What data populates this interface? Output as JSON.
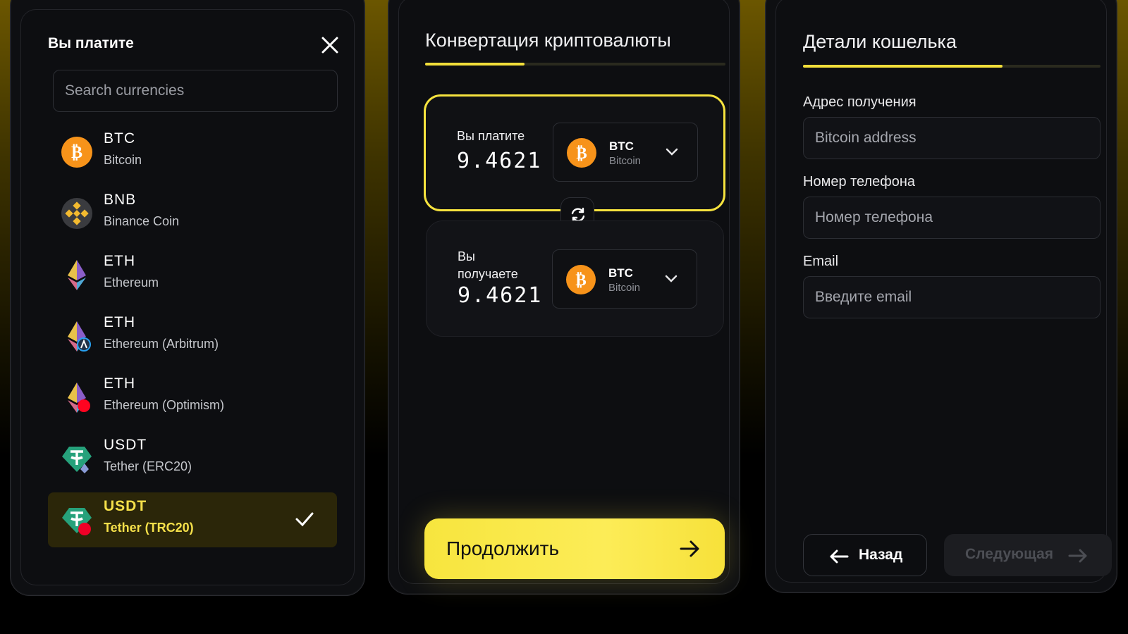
{
  "picker": {
    "title": "Вы платите",
    "search_placeholder": "Search currencies",
    "items": [
      {
        "symbol": "BTC",
        "name": "Bitcoin",
        "icon": "bitcoin-icon"
      },
      {
        "symbol": "BNB",
        "name": "Binance Coin",
        "icon": "binance-icon"
      },
      {
        "symbol": "ETH",
        "name": "Ethereum",
        "icon": "ethereum-icon"
      },
      {
        "symbol": "ETH",
        "name": "Ethereum (Arbitrum)",
        "icon": "ethereum-arbitrum-icon"
      },
      {
        "symbol": "ETH",
        "name": "Ethereum (Optimism)",
        "icon": "ethereum-optimism-icon"
      },
      {
        "symbol": "USDT",
        "name": "Tether (ERC20)",
        "icon": "tether-erc20-icon"
      },
      {
        "symbol": "USDT",
        "name": "Tether (TRC20)",
        "icon": "tether-trc20-icon",
        "selected": true
      }
    ]
  },
  "converter": {
    "title": "Конвертация криптовалюты",
    "progress": 0.33,
    "pay": {
      "label": "Вы платите",
      "amount": "9.46210",
      "symbol": "BTC",
      "name": "Bitcoin"
    },
    "receive": {
      "label": "Вы получаете",
      "amount": "9.46210",
      "symbol": "BTC",
      "name": "Bitcoin"
    },
    "continue_label": "Продолжить"
  },
  "wallet": {
    "title": "Детали кошелька",
    "progress": 0.67,
    "address_label": "Адрес получения",
    "address_placeholder": "Bitcoin address",
    "phone_label": "Номер телефона",
    "phone_placeholder": "Номер телефона",
    "email_label": "Email",
    "email_placeholder": "Введите email",
    "back_label": "Назад",
    "next_label": "Следующая"
  },
  "colors": {
    "accent": "#f6e33e",
    "bitcoin": "#f7931a",
    "bnb": "#f3ba2f",
    "tether": "#26a17b"
  }
}
